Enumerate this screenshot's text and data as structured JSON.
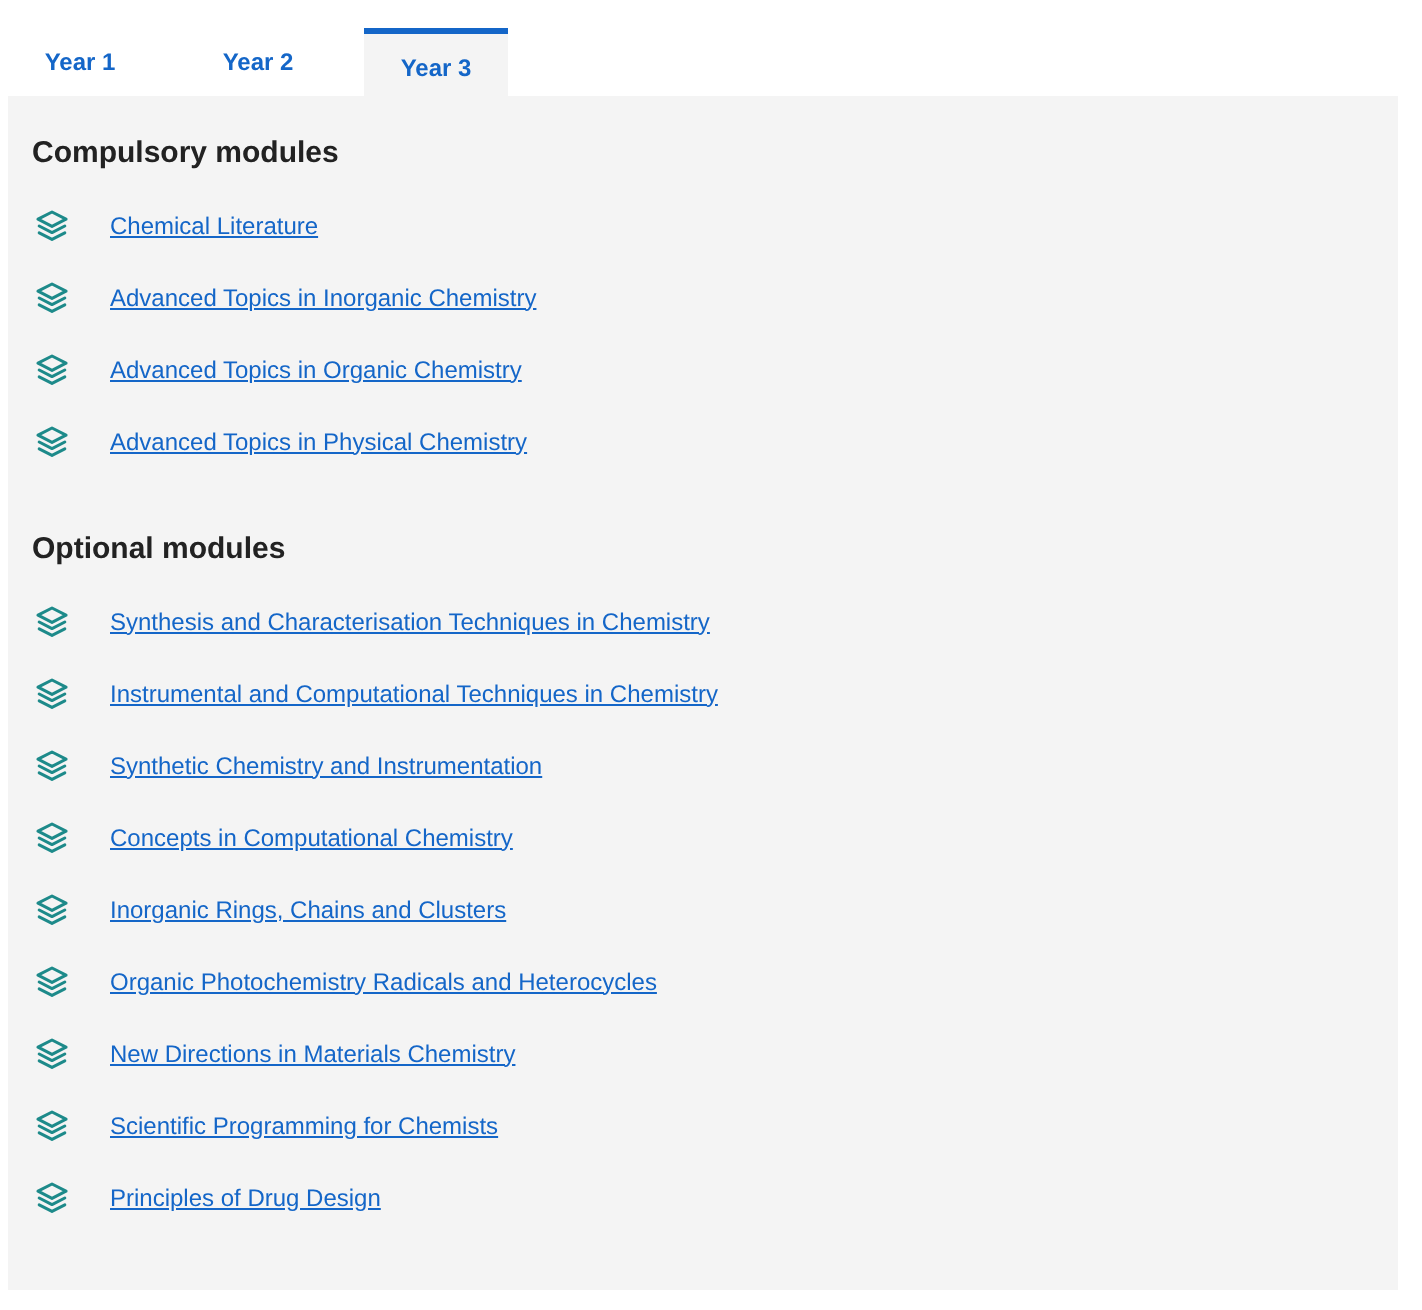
{
  "tabs": [
    {
      "label": "Year 1",
      "selected": false
    },
    {
      "label": "Year 2",
      "selected": false
    },
    {
      "label": "Year 3",
      "selected": true
    }
  ],
  "sections": [
    {
      "heading": "Compulsory modules",
      "modules": [
        "Chemical Literature",
        "Advanced Topics in Inorganic Chemistry",
        "Advanced Topics in Organic Chemistry",
        "Advanced Topics in Physical Chemistry"
      ]
    },
    {
      "heading": "Optional modules",
      "modules": [
        "Synthesis and Characterisation Techniques in Chemistry",
        "Instrumental and Computational Techniques in Chemistry",
        "Synthetic Chemistry and Instrumentation",
        "Concepts in Computational Chemistry",
        "Inorganic Rings, Chains and Clusters",
        "Organic Photochemistry Radicals and Heterocycles",
        "New Directions in Materials Chemistry",
        "Scientific Programming for Chemists",
        "Principles of Drug Design"
      ]
    }
  ]
}
